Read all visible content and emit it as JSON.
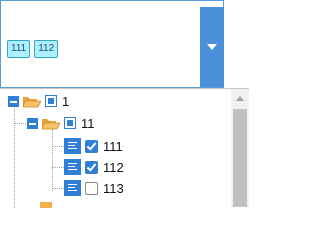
{
  "select": {
    "tags": [
      "111",
      "112"
    ]
  },
  "tree": {
    "root": {
      "label": "1",
      "state": "partial"
    },
    "child": {
      "label": "11",
      "state": "partial"
    },
    "leaves": [
      {
        "label": "111",
        "checked": true
      },
      {
        "label": "112",
        "checked": true
      },
      {
        "label": "113",
        "checked": false
      }
    ]
  },
  "colors": {
    "accent": "#4a90d9",
    "tag_bg": "#aef0ff",
    "folder": "#f0b04a"
  },
  "icons": {
    "dropdown": "caret-down-icon",
    "folder": "folder-open-icon",
    "leaf": "document-icon"
  }
}
